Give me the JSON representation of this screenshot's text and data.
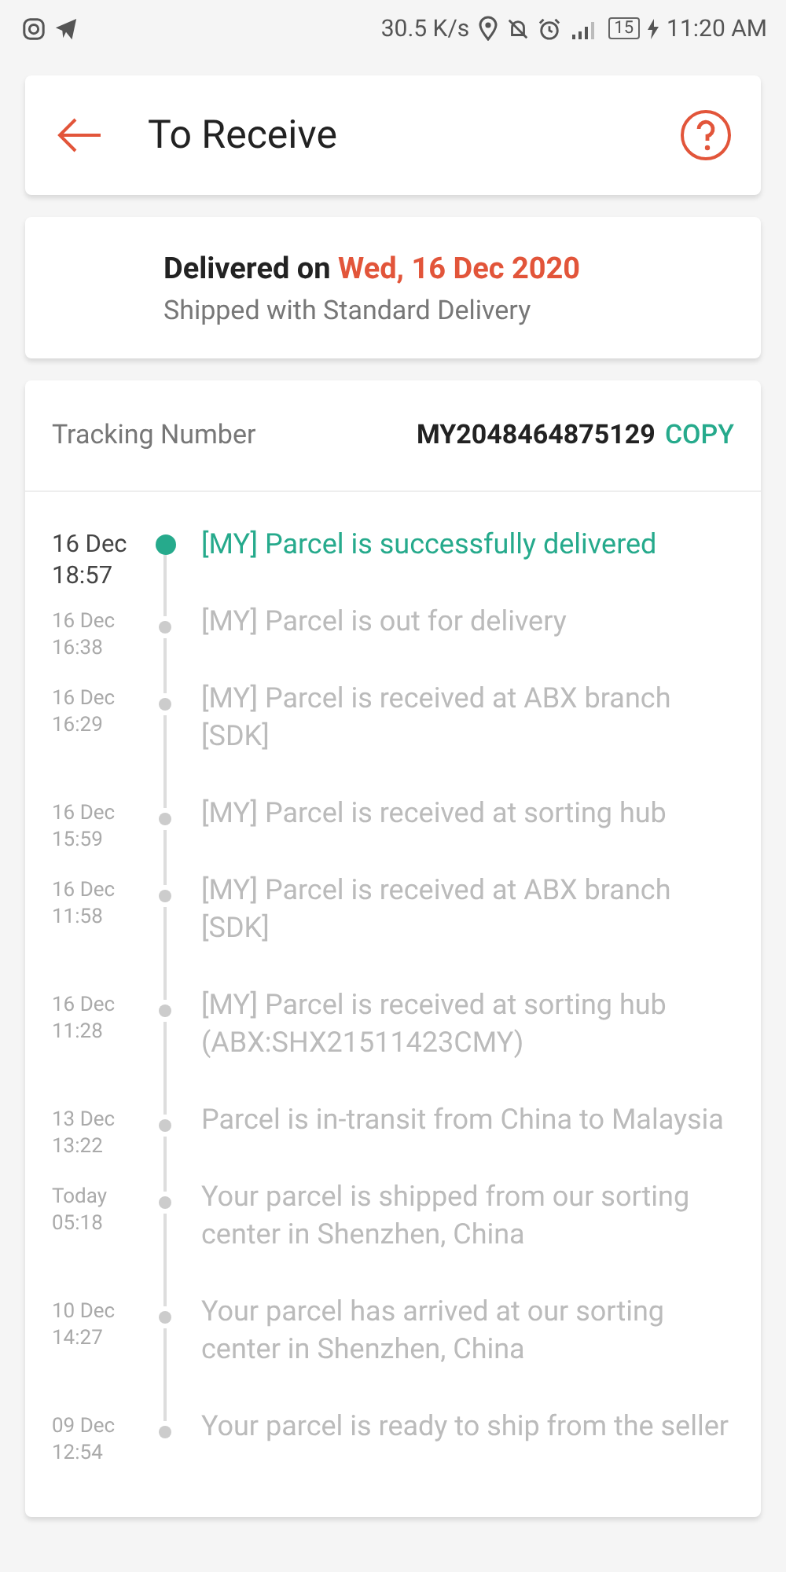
{
  "status_bar": {
    "speed": "30.5 K/s",
    "battery": "15",
    "time": "11:20 AM"
  },
  "header": {
    "title": "To Receive"
  },
  "delivery": {
    "label": "Delivered on",
    "date": "Wed, 16 Dec 2020",
    "method": "Shipped with Standard Delivery"
  },
  "tracking": {
    "label": "Tracking Number",
    "number": "MY2048464875129",
    "copy": "COPY"
  },
  "events": [
    {
      "date": "16 Dec",
      "time": "18:57",
      "text": "[MY] Parcel is successfully delivered",
      "current": true
    },
    {
      "date": "16 Dec",
      "time": "16:38",
      "text": "[MY] Parcel is out for delivery",
      "current": false
    },
    {
      "date": "16 Dec",
      "time": "16:29",
      "text": "[MY] Parcel is received at ABX branch [SDK]",
      "current": false
    },
    {
      "date": "16 Dec",
      "time": "15:59",
      "text": "[MY] Parcel is received at sorting hub",
      "current": false
    },
    {
      "date": "16 Dec",
      "time": "11:58",
      "text": "[MY] Parcel is received at ABX branch [SDK]",
      "current": false
    },
    {
      "date": "16 Dec",
      "time": "11:28",
      "text": "[MY] Parcel is received at sorting hub (ABX:SHX21511423CMY)",
      "current": false
    },
    {
      "date": "13 Dec",
      "time": "13:22",
      "text": "Parcel is in-transit from China to Malaysia",
      "current": false
    },
    {
      "date": "Today",
      "time": "05:18",
      "text": "Your parcel is shipped from our sorting center in Shenzhen, China",
      "current": false
    },
    {
      "date": "10 Dec",
      "time": "14:27",
      "text": "Your parcel has arrived at our sorting center in Shenzhen, China",
      "current": false
    },
    {
      "date": "09 Dec",
      "time": "12:54",
      "text": "Your parcel is ready to ship from the seller",
      "current": false
    }
  ]
}
